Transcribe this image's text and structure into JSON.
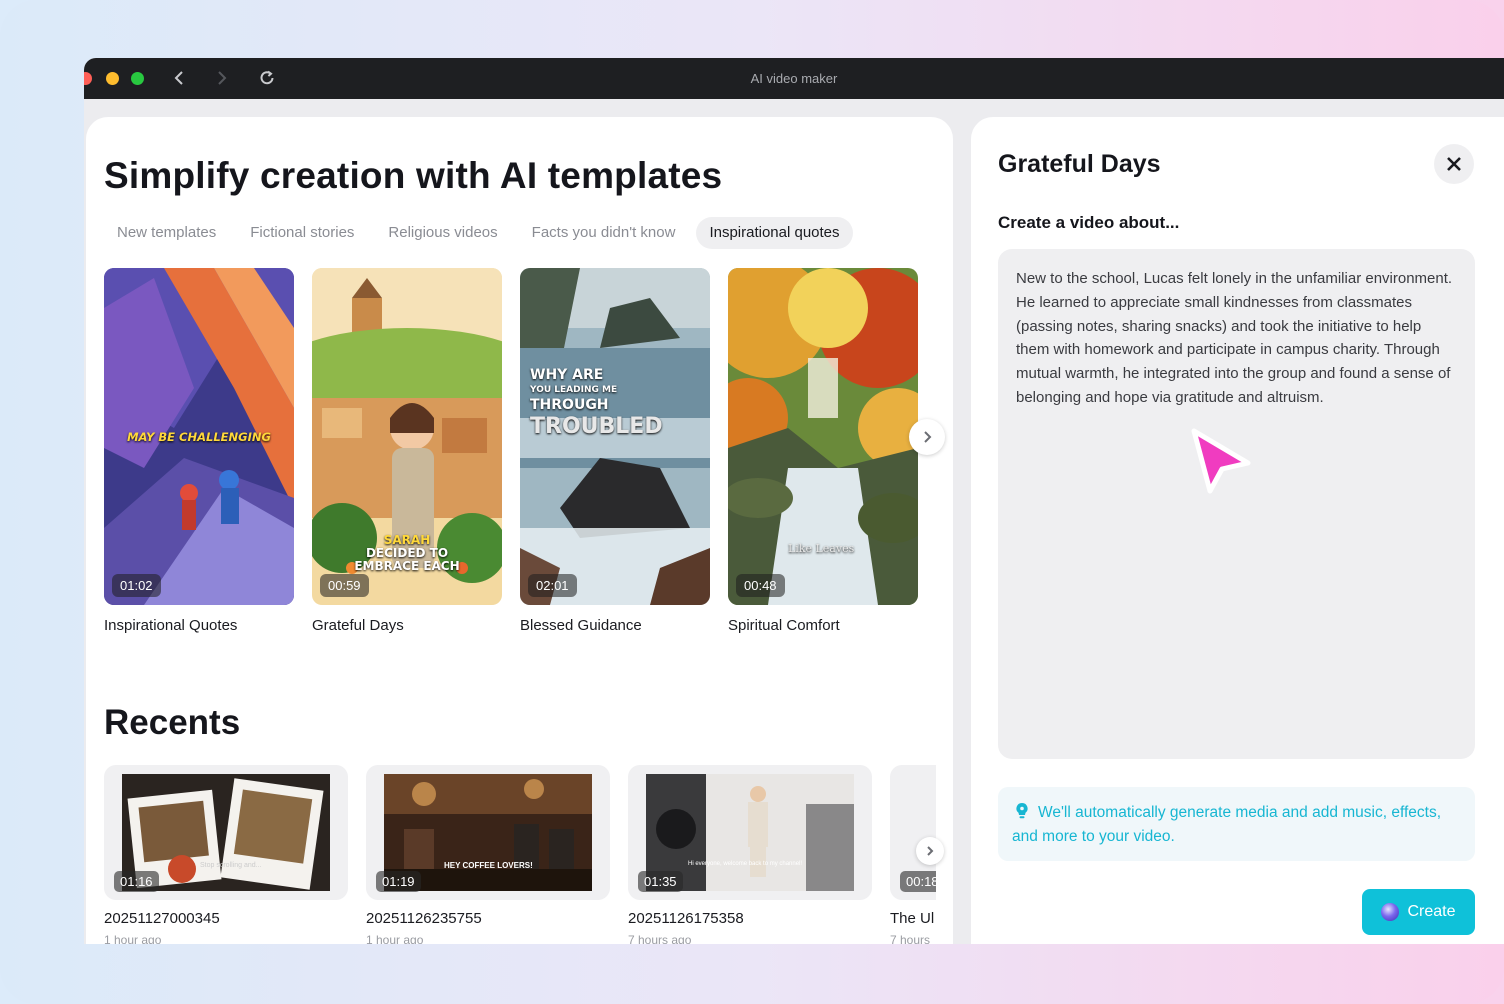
{
  "window": {
    "title": "AI video maker"
  },
  "hero": {
    "title": "Simplify creation with AI templates"
  },
  "tabs": [
    {
      "label": "New templates",
      "active": false
    },
    {
      "label": "Fictional stories",
      "active": false
    },
    {
      "label": "Religious videos",
      "active": false
    },
    {
      "label": "Facts you didn't know",
      "active": false
    },
    {
      "label": "Inspirational quotes",
      "active": true
    }
  ],
  "templates": [
    {
      "title": "Inspirational Quotes",
      "duration": "01:02",
      "caption": "MAY BE CHALLENGING"
    },
    {
      "title": "Grateful Days",
      "duration": "00:59",
      "caption_lines": [
        "SARAH",
        "DECIDED TO",
        "EMBRACE EACH"
      ]
    },
    {
      "title": "Blessed Guidance",
      "duration": "02:01",
      "caption_lines": [
        "WHY ARE",
        "YOU LEADING ME",
        "THROUGH",
        "TROUBLED"
      ]
    },
    {
      "title": "Spiritual Comfort",
      "duration": "00:48",
      "caption": "Like Leaves"
    }
  ],
  "recents": {
    "title": "Recents",
    "items": [
      {
        "name": "20251127000345",
        "time": "1 hour ago",
        "duration": "01:16",
        "caption": "Stop scrolling and..."
      },
      {
        "name": "20251126235755",
        "time": "1 hour ago",
        "duration": "01:19",
        "caption": "HEY COFFEE LOVERS!"
      },
      {
        "name": "20251126175358",
        "time": "7 hours ago",
        "duration": "01:35",
        "caption": "Hi everyone, welcome back to my channel!"
      },
      {
        "name": "The Ul",
        "time": "7 hours",
        "duration": "00:18"
      }
    ]
  },
  "detail": {
    "title": "Grateful Days",
    "subtitle": "Create a video about...",
    "prompt": "New to the school, Lucas felt lonely in the unfamiliar environment. He learned to appreciate small kindnesses from classmates (passing notes, sharing snacks) and took the initiative to help them with homework and participate in campus charity. Through mutual warmth, he integrated into the group and found a sense of belonging and hope via gratitude and altruism.",
    "info": "We'll automatically generate media and add music, effects, and more to your video.",
    "create_label": "Create"
  },
  "colors": {
    "accent": "#0fc1d9",
    "info_text": "#17b6d2",
    "pointer": "#f03cc0"
  }
}
